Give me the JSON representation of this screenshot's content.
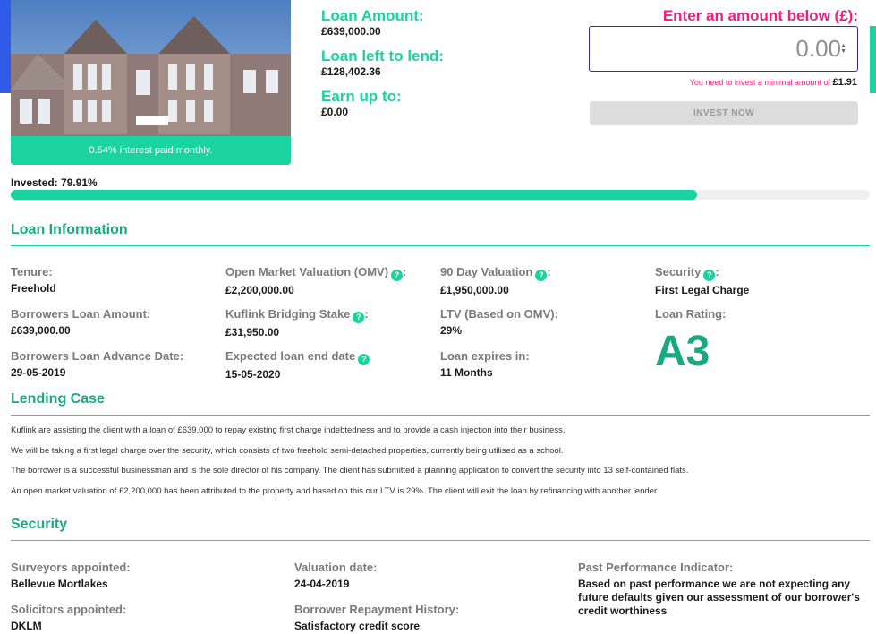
{
  "hero": {
    "interest_text": "0.54% interest paid monthly."
  },
  "stats": {
    "loan_amount_label": "Loan Amount:",
    "loan_amount_value": "£639,000.00",
    "left_label": "Loan left to lend:",
    "left_value": "£128,402.36",
    "earn_label": "Earn up to:",
    "earn_value": "£0.00"
  },
  "invest": {
    "enter_label": "Enter an amount below (£):",
    "amount_value": "0.00",
    "min_note": "You need to invest a minimal amount of",
    "min_amount": "£1.91",
    "button_label": "INVEST NOW"
  },
  "progress": {
    "label": "Invested: 79.91%",
    "percent": 79.91
  },
  "loan_info": {
    "title": "Loan Information",
    "tenure_label": "Tenure:",
    "tenure_value": "Freehold",
    "omv_label": "Open Market Valuation (OMV)",
    "omv_value": "£2,200,000.00",
    "ninety_label": "90 Day Valuation",
    "ninety_value": "£1,950,000.00",
    "security_label": "Security",
    "security_value": "First Legal Charge",
    "borrowers_amount_label": "Borrowers Loan Amount:",
    "borrowers_amount_value": "£639,000.00",
    "bridging_label": "Kuflink Bridging Stake",
    "bridging_value": "£31,950.00",
    "ltv_label": "LTV (Based on OMV):",
    "ltv_value": "29%",
    "rating_label": "Loan Rating:",
    "rating_value": "A3",
    "advance_label": "Borrowers Loan Advance Date:",
    "advance_value": "29-05-2019",
    "end_label": "Expected loan end date",
    "end_value": "15-05-2020",
    "expires_label": "Loan expires in:",
    "expires_value": "11 Months"
  },
  "lending_case": {
    "title": "Lending Case",
    "paragraphs": [
      "Kuflink are assisting the client with a loan of £639,000 to repay existing first charge indebtedness and to provide a cash injection into their business.",
      "We will be taking a first legal charge over the security, which consists of two freehold semi-detached properties, currently being utilised as a school.",
      "The borrower is a successful businessman and is the sole director of his company. The client has submitted a planning application to convert the security into 13 self-contained flats.",
      "An open market valuation of £2,200,000 has been attributed to the property and based on this our LTV is 29%. The client will exit the loan by refinancing with another lender."
    ]
  },
  "security": {
    "title": "Security",
    "surveyors_label": "Surveyors appointed:",
    "surveyors_value": "Bellevue Mortlakes",
    "valuation_label": "Valuation date:",
    "valuation_value": "24-04-2019",
    "ppi_label": "Past Performance Indicator:",
    "ppi_value": "Based on past performance we are not expecting any future defaults given our assessment of our borrower's credit worthiness",
    "solicitors_label": "Solicitors appointed:",
    "solicitors_value": "DKLM",
    "repayment_label": "Borrower Repayment History:",
    "repayment_value": "Satisfactory credit score"
  },
  "colors": {
    "accent": "#1ad3a1",
    "accent_dark": "#19a880",
    "pink": "#ee1f7f",
    "blue": "#2f5be8"
  }
}
